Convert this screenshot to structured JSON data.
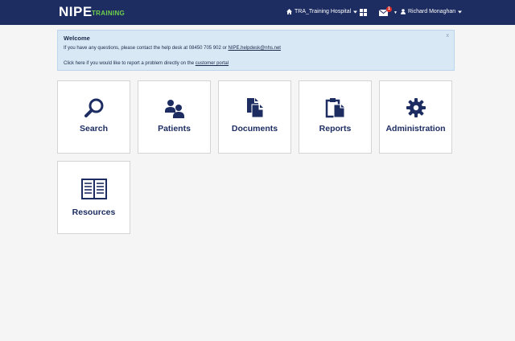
{
  "header": {
    "brand": "NIPE",
    "brand_sub": "TRAINING",
    "hospital": "TRA_Training Hospital",
    "messages_count": "1",
    "user": "Richard Monaghan",
    "icons": {
      "home": "home-icon",
      "grid": "grid-icon",
      "mail": "envelope-icon",
      "user": "user-icon",
      "caret": "caret-down-icon"
    }
  },
  "alert": {
    "title": "Welcome",
    "line1_prefix": "If you have any questions, please contact the help desk at 08450 705 902 or ",
    "line1_link": "NIPE.helpdesk@nhs.net",
    "line2_prefix": "Click here if you would like to report a problem directly on the ",
    "line2_link": "customer portal",
    "close": "x"
  },
  "tiles": [
    {
      "label": "Search",
      "icon": "magnifier-icon"
    },
    {
      "label": "Patients",
      "icon": "users-icon"
    },
    {
      "label": "Documents",
      "icon": "documents-icon"
    },
    {
      "label": "Reports",
      "icon": "clipboard-icon"
    },
    {
      "label": "Administration",
      "icon": "gear-icon"
    },
    {
      "label": "Resources",
      "icon": "book-icon"
    }
  ],
  "colors": {
    "navbar": "#1d2d62",
    "accent": "#6fcf4a",
    "alert_bg": "#d8e8f5",
    "tile_text": "#1d2d62",
    "badge": "#d9322c"
  }
}
